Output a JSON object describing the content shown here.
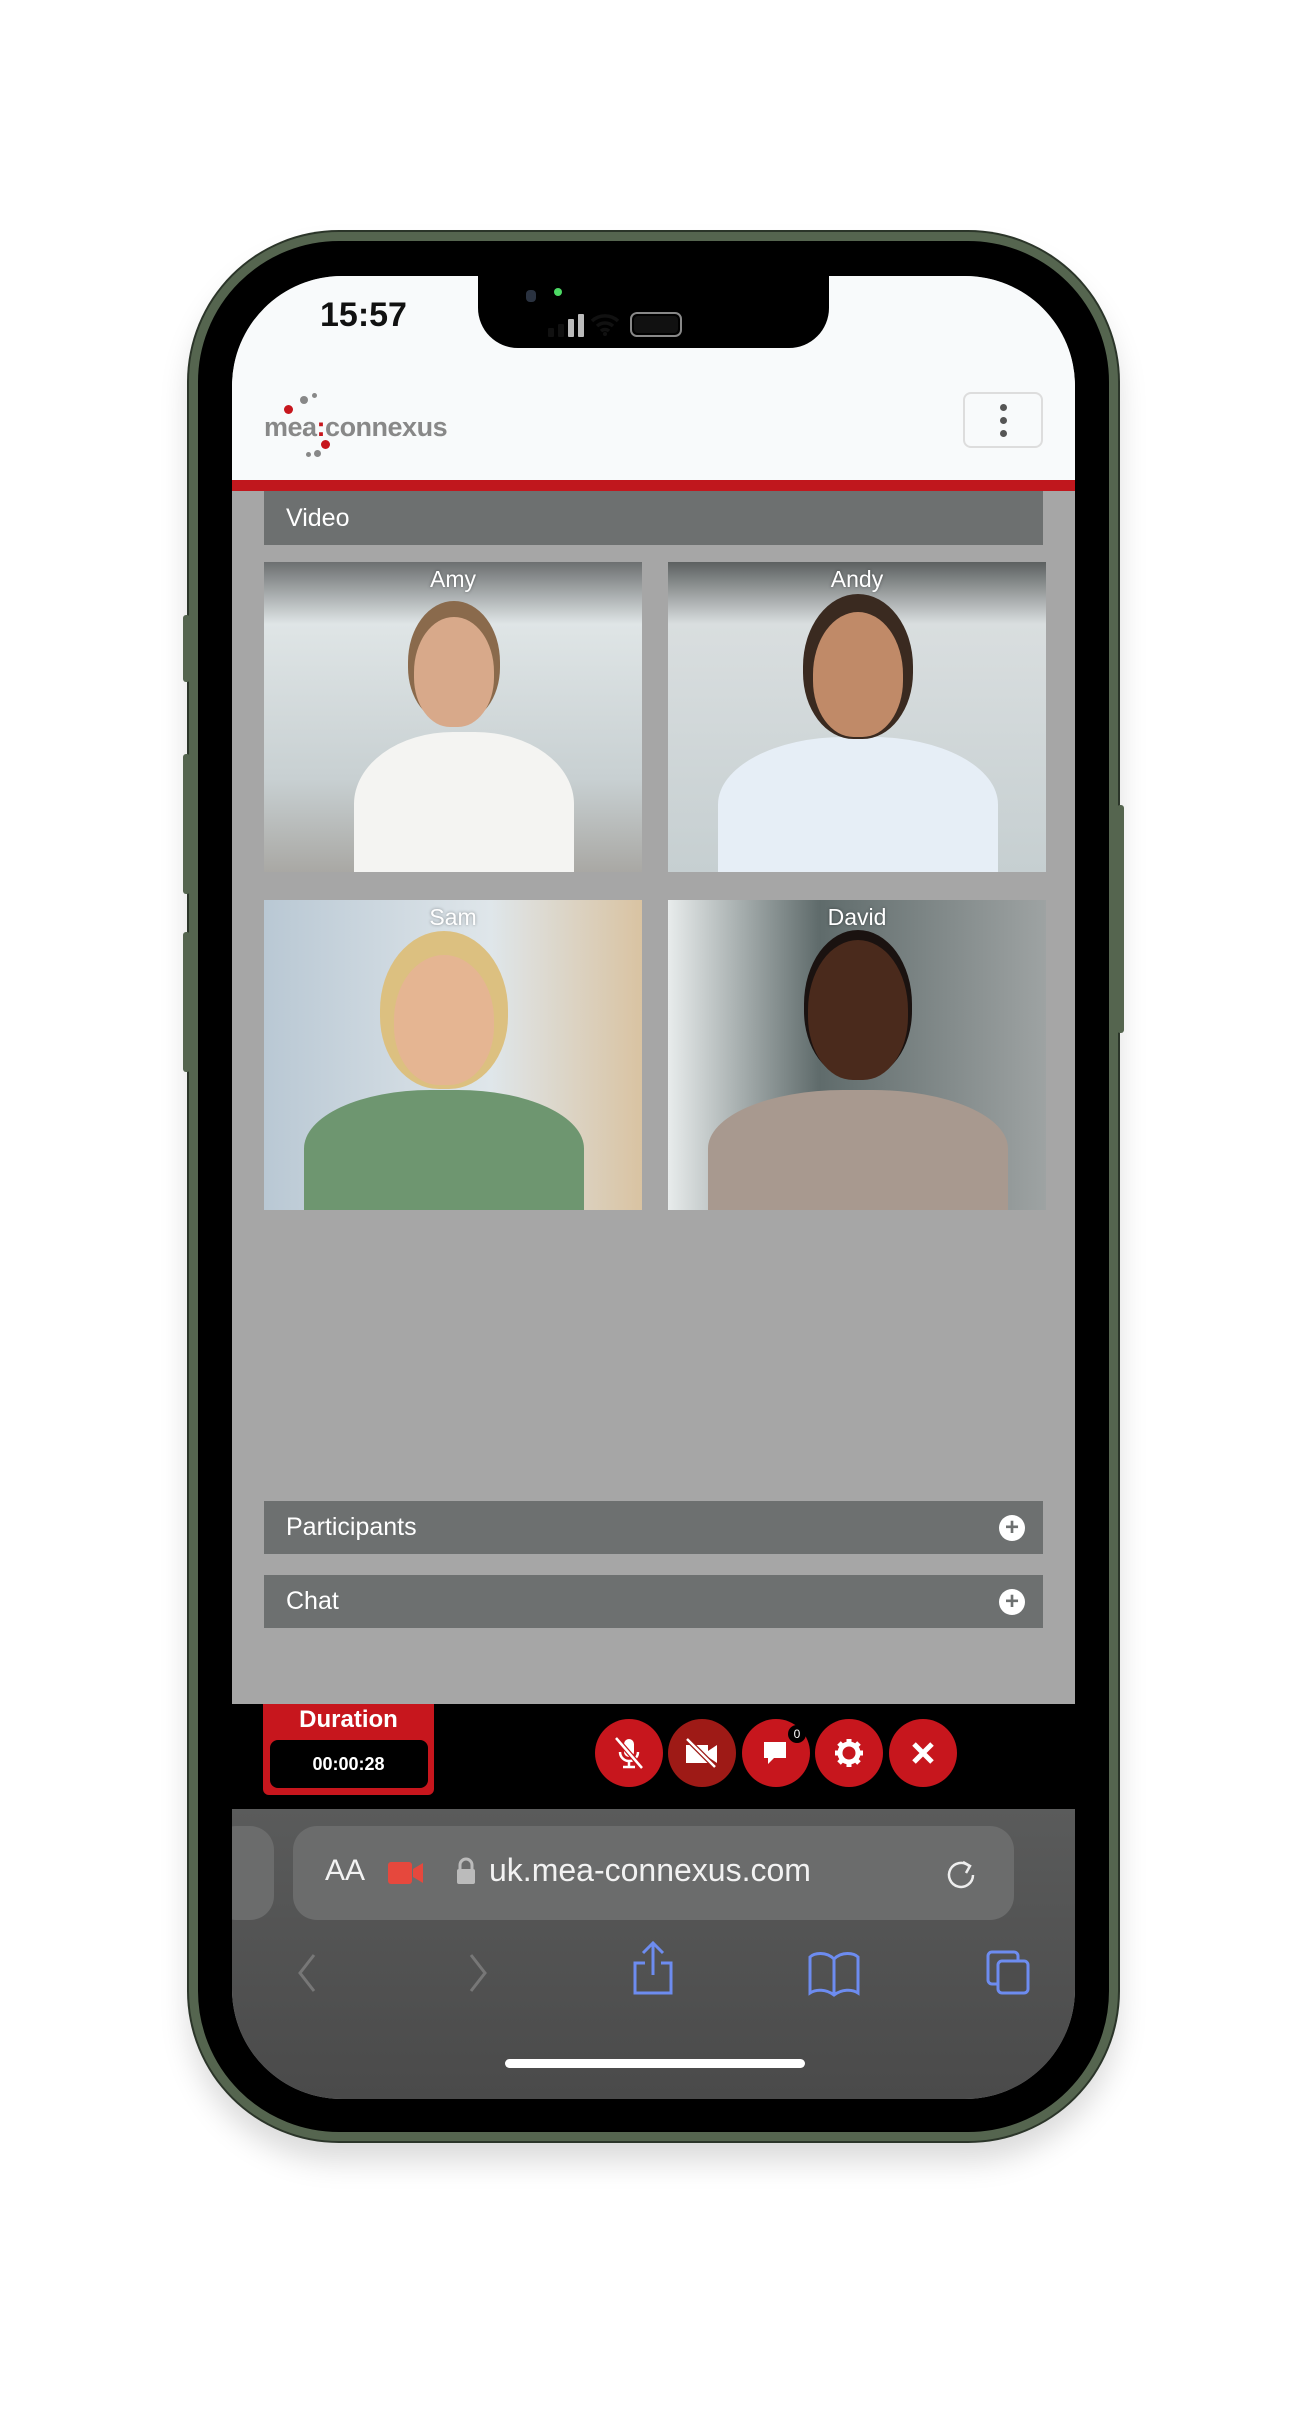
{
  "status_bar": {
    "time": "15:57"
  },
  "header": {
    "logo": "mea:connexus",
    "menu_icon": "kebab-menu-icon"
  },
  "video": {
    "title": "Video",
    "participants": [
      {
        "name": "Amy"
      },
      {
        "name": "Andy"
      },
      {
        "name": "Sam"
      },
      {
        "name": "David"
      }
    ]
  },
  "panels": {
    "participants": "Participants",
    "chat": "Chat"
  },
  "controls": {
    "duration_label": "Duration",
    "duration_value": "00:00:28",
    "chat_badge": "0",
    "buttons": [
      "mic-muted-icon",
      "camera-off-icon",
      "chat-icon",
      "settings-icon",
      "close-icon"
    ]
  },
  "colors": {
    "brand_red": "#c7161d",
    "bar_gray": "#6d7070",
    "content_gray": "#a6a6a6"
  },
  "browser": {
    "text_size": "AA",
    "url": "uk.mea-connexus.com"
  }
}
